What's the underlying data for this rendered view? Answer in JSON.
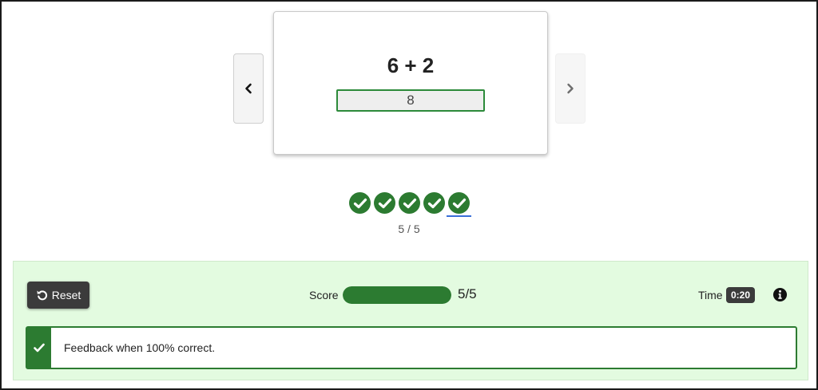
{
  "card": {
    "question": "6 + 2",
    "answer": "8"
  },
  "navigation": {
    "prev_icon": "chevron-left-icon",
    "next_icon": "chevron-right-icon"
  },
  "progress": {
    "dots": [
      {
        "status": "correct",
        "icon": "check-circle-icon"
      },
      {
        "status": "correct",
        "icon": "check-circle-icon"
      },
      {
        "status": "correct",
        "icon": "check-circle-icon"
      },
      {
        "status": "correct",
        "icon": "check-circle-icon"
      },
      {
        "status": "correct",
        "icon": "check-circle-icon",
        "current": true
      }
    ],
    "text": "5 / 5"
  },
  "panel": {
    "reset_label": "Reset",
    "score_label": "Score",
    "score_value": "5/5",
    "score_fraction": 1.0,
    "time_label": "Time",
    "time_value": "0:20",
    "info_icon": "info-icon"
  },
  "feedback": {
    "text": "Feedback when 100% correct.",
    "icon": "checkmark-icon"
  },
  "colors": {
    "success": "#2c7b31",
    "panel_bg": "#e3fbe0",
    "dark_button": "#3b3b3b",
    "focus_underline": "#3a6fd8"
  }
}
